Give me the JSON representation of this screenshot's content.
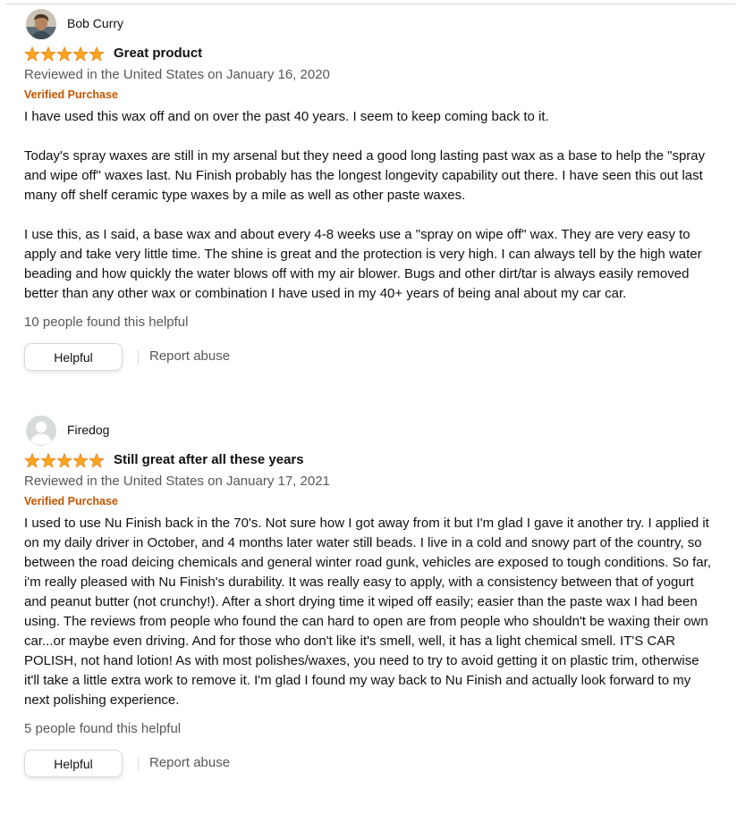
{
  "reviews": [
    {
      "profile_name": "Bob Curry",
      "rating": 5,
      "title": "Great product",
      "date_text": "Reviewed in the United States on January 16, 2020",
      "verified": "Verified Purchase",
      "body": [
        "I have used this wax off and on over the past 40 years. I seem to keep coming back to it.",
        "Today's spray waxes are still in my arsenal but they need a good long lasting past wax as a base to help the \"spray and wipe off\" waxes last. Nu Finish probably has the longest longevity capability out there. I have seen this out last many off shelf ceramic type waxes by a mile as well as other paste waxes.",
        "I use this, as I said, a base wax and about every 4-8 weeks use a \"spray on wipe off\" wax. They are very easy to apply and take very little time. The shine is great and the protection is very high. I can always tell by the high water beading and how quickly the water blows off with my air blower. Bugs and other dirt/tar is always easily removed better than any other wax or combination I have used in my 40+ years of being anal about my car car."
      ],
      "helpful_text": "10 people found this helpful",
      "helpful_button": "Helpful",
      "report_link": "Report abuse"
    },
    {
      "profile_name": "Firedog",
      "rating": 5,
      "title": "Still great after all these years",
      "date_text": "Reviewed in the United States on January 17, 2021",
      "verified": "Verified Purchase",
      "body": [
        "I used to use Nu Finish back in the 70's. Not sure how I got away from it but I'm glad I gave it another try. I applied it on my daily driver in October, and 4 months later water still beads. I live in a cold and snowy part of the country, so between the road deicing chemicals and general winter road gunk, vehicles are exposed to tough conditions. So far,\ni'm really pleased with Nu Finish's durability. It was really easy to apply, with a consistency between that of yogurt and peanut butter (not crunchy!). After a short drying time it wiped off easily; easier than the paste wax I had been using. The reviews from people who found the can hard to open are from people who shouldn't be waxing their own car...or maybe even driving. And for those who don't like it's smell, well, it has a light chemical smell. IT'S CAR POLISH, not hand lotion! As with most polishes/waxes, you need to try to avoid getting it on plastic trim, otherwise it'll take a little extra work to remove it. I'm glad I found my way back to Nu Finish and actually look forward to my next polishing experience."
      ],
      "helpful_text": "5 people found this helpful",
      "helpful_button": "Helpful",
      "report_link": "Report abuse"
    }
  ],
  "colors": {
    "star": "#ffa41c",
    "verified": "#c45500",
    "muted": "#565959",
    "text": "#0f1111"
  },
  "icons": {
    "avatar_1": "user-photo-avatar",
    "avatar_2": "default-user-avatar",
    "star": "star-icon"
  }
}
